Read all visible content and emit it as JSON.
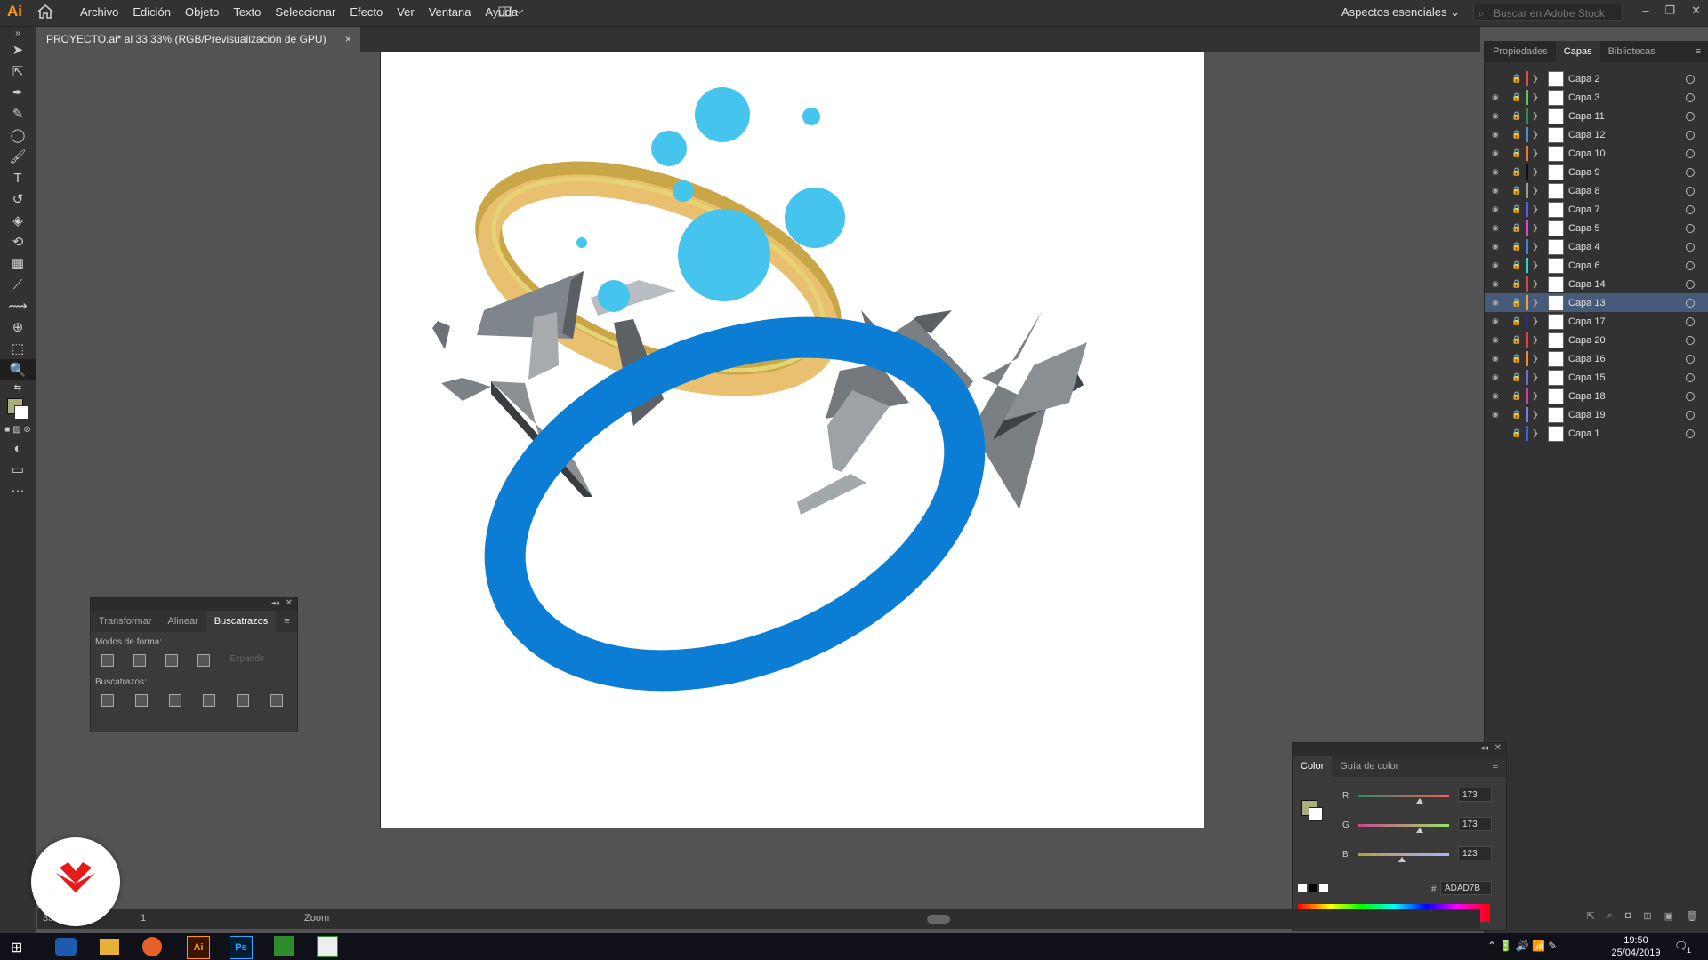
{
  "app": {
    "logo": "Ai",
    "menu": [
      "Archivo",
      "Edición",
      "Objeto",
      "Texto",
      "Seleccionar",
      "Efecto",
      "Ver",
      "Ventana",
      "Ayuda"
    ],
    "workspace": "Aspectos esenciales",
    "search_placeholder": "Buscar en Adobe Stock"
  },
  "document": {
    "tab_title": "PROYECTO.ai* al 33,33% (RGB/Previsualización de GPU)",
    "close": "×"
  },
  "status": {
    "zoom": "33",
    "page": "1",
    "tool": "Zoom"
  },
  "layers_panel": {
    "tabs": [
      "Propiedades",
      "Capas",
      "Bibliotecas"
    ],
    "active_tab": "Capas",
    "layers": [
      {
        "name": "Capa 2",
        "color": "#e84b4b",
        "visible": false,
        "selected": false
      },
      {
        "name": "Capa 3",
        "color": "#5ac85a",
        "visible": true,
        "selected": false
      },
      {
        "name": "Capa 11",
        "color": "#2e8b57",
        "visible": true,
        "selected": false
      },
      {
        "name": "Capa 12",
        "color": "#4a90d9",
        "visible": true,
        "selected": false
      },
      {
        "name": "Capa 10",
        "color": "#e8792e",
        "visible": true,
        "selected": false
      },
      {
        "name": "Capa 9",
        "color": "#111111",
        "visible": true,
        "selected": false
      },
      {
        "name": "Capa 8",
        "color": "#9a9a9a",
        "visible": true,
        "selected": false
      },
      {
        "name": "Capa 7",
        "color": "#5a5af0",
        "visible": true,
        "selected": false
      },
      {
        "name": "Capa 5",
        "color": "#d24cd2",
        "visible": true,
        "selected": false
      },
      {
        "name": "Capa 4",
        "color": "#3f7fe0",
        "visible": true,
        "selected": false
      },
      {
        "name": "Capa 6",
        "color": "#2ed2d2",
        "visible": true,
        "selected": false
      },
      {
        "name": "Capa 14",
        "color": "#c94a4a",
        "visible": true,
        "selected": false
      },
      {
        "name": "Capa 13",
        "color": "#e8a040",
        "visible": true,
        "selected": true
      },
      {
        "name": "Capa 17",
        "color": "#2a2a8a",
        "visible": true,
        "selected": false
      },
      {
        "name": "Capa 20",
        "color": "#e04040",
        "visible": true,
        "selected": false
      },
      {
        "name": "Capa 16",
        "color": "#f08a2a",
        "visible": true,
        "selected": false
      },
      {
        "name": "Capa 15",
        "color": "#6a6ae0",
        "visible": true,
        "selected": false
      },
      {
        "name": "Capa 18",
        "color": "#d040a0",
        "visible": true,
        "selected": false
      },
      {
        "name": "Capa 19",
        "color": "#7a7af0",
        "visible": true,
        "selected": false
      },
      {
        "name": "Capa 1",
        "color": "#3f5fd0",
        "visible": false,
        "selected": false
      }
    ]
  },
  "pathfinder": {
    "tabs": [
      "Transformar",
      "Alinear",
      "Buscatrazos"
    ],
    "active_tab": "Buscatrazos",
    "shape_modes_label": "Modos de forma:",
    "expand_label": "Expandir",
    "pathfinders_label": "Buscatrazos:"
  },
  "color_panel": {
    "tabs": [
      "Color",
      "Guía de color"
    ],
    "active_tab": "Color",
    "r": "173",
    "g": "173",
    "b": "123",
    "r_level": 0.678,
    "g_level": 0.678,
    "b_level": 0.482,
    "hex_label": "#",
    "hex": "ADAD7B",
    "fill_color": "#ADAD7B"
  },
  "taskbar": {
    "time": "19:50",
    "date": "25/04/2019",
    "notif": "1"
  },
  "artwork": {
    "ring_blue": "#0b7dd4",
    "ring_gold": "#e8c070",
    "bubble": "#45c4ee",
    "shard_gray": "#8a8a8a"
  }
}
